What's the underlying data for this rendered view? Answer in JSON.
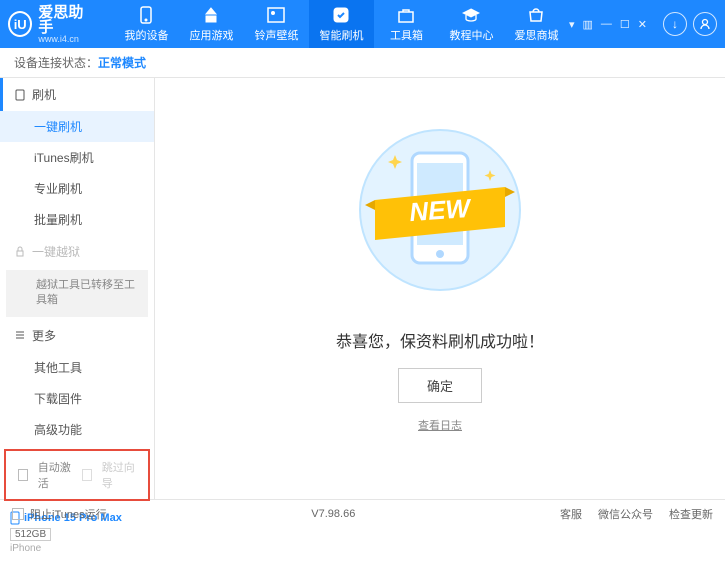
{
  "header": {
    "logo_letter": "iU",
    "app_name": "爱思助手",
    "url": "www.i4.cn",
    "nav": [
      {
        "label": "我的设备"
      },
      {
        "label": "应用游戏"
      },
      {
        "label": "铃声壁纸"
      },
      {
        "label": "智能刷机"
      },
      {
        "label": "工具箱"
      },
      {
        "label": "教程中心"
      },
      {
        "label": "爱思商城"
      }
    ]
  },
  "status": {
    "label": "设备连接状态：",
    "mode": "正常模式"
  },
  "sidebar": {
    "group_flash": "刷机",
    "items_flash": [
      "一键刷机",
      "iTunes刷机",
      "专业刷机",
      "批量刷机"
    ],
    "group_jailbreak": "一键越狱",
    "jailbreak_note": "越狱工具已转移至工具箱",
    "group_more": "更多",
    "items_more": [
      "其他工具",
      "下载固件",
      "高级功能"
    ],
    "auto_activate": "自动激活",
    "skip_guide": "跳过向导",
    "device_name": "iPhone 15 Pro Max",
    "device_capacity": "512GB",
    "device_type": "iPhone"
  },
  "content": {
    "banner_text": "NEW",
    "success_msg": "恭喜您，保资料刷机成功啦！",
    "ok_label": "确定",
    "log_link": "查看日志"
  },
  "footer": {
    "block_itunes": "阻止iTunes运行",
    "version": "V7.98.66",
    "links": [
      "客服",
      "微信公众号",
      "检查更新"
    ]
  }
}
